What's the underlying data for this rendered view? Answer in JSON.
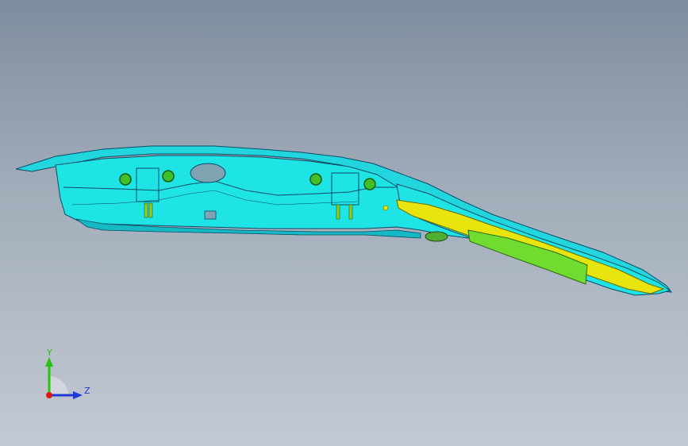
{
  "viewport": {
    "background_top": "#7e8d9e",
    "background_bottom": "#c3c9d3"
  },
  "model": {
    "part_colors": {
      "rail": "#1fe4e6",
      "rail_dark": "#14b9c4",
      "edge": "#0a4c66",
      "reinforcement": "#e8e40e",
      "bracket": "#6fdc2f",
      "bolt": "#3fbf2a"
    }
  },
  "triad": {
    "labels": {
      "y": "Y",
      "z": "Z"
    },
    "colors": {
      "y": "#27c20f",
      "z": "#1f3bd6",
      "x": "#e01515"
    }
  }
}
